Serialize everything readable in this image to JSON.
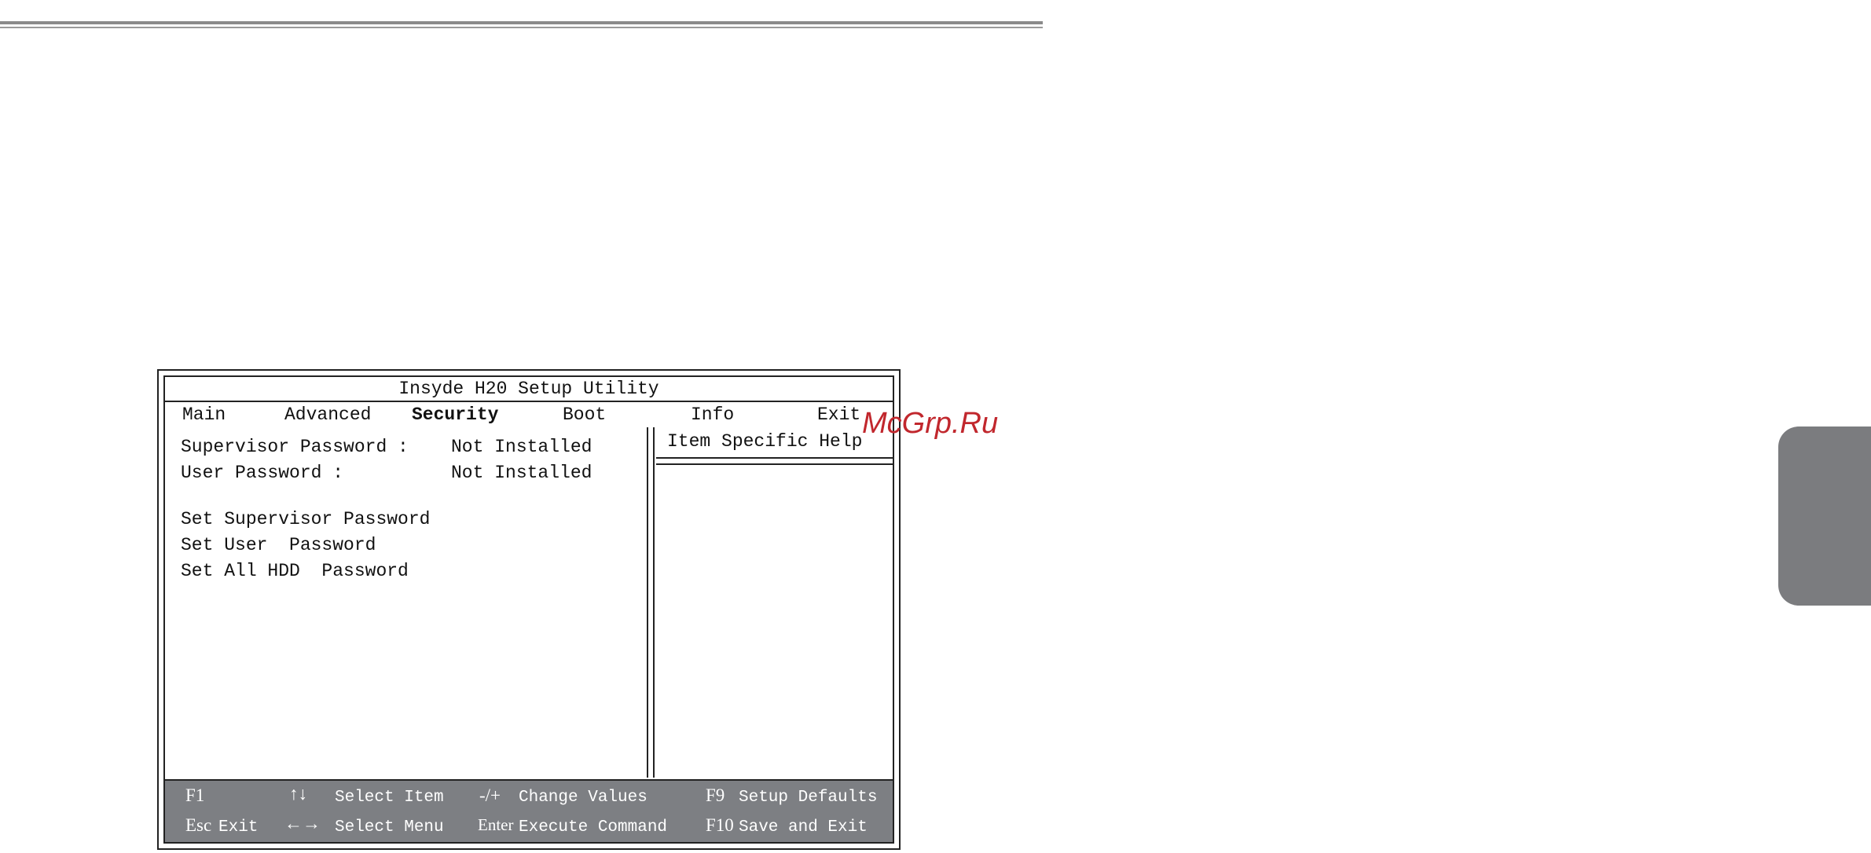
{
  "app": {
    "title": "Insyde H20 Setup Utility"
  },
  "menu": {
    "items": [
      {
        "label": "Main"
      },
      {
        "label": "Advanced"
      },
      {
        "label": "Security",
        "active": true
      },
      {
        "label": "Boot"
      },
      {
        "label": "Info"
      },
      {
        "label": "Exit"
      }
    ]
  },
  "security": {
    "supervisor_label": "Supervisor Password :",
    "supervisor_value": "Not Installed",
    "user_label": "User Password :",
    "user_value": "Not Installed",
    "actions": [
      "Set Supervisor Password",
      "Set User  Password",
      "Set All HDD  Password"
    ]
  },
  "help": {
    "title": "Item Specific Help"
  },
  "footer": {
    "keys": [
      {
        "key": "F1",
        "desc": ""
      },
      {
        "key": "↑↓",
        "desc": "Select Item"
      },
      {
        "key": "-/+",
        "desc": "Change Values"
      },
      {
        "key": "F9",
        "desc": "Setup Defaults"
      },
      {
        "key": "Esc",
        "desc": "Exit"
      },
      {
        "key": "←→",
        "desc": "Select Menu"
      },
      {
        "key": "Enter",
        "desc": "Execute Command"
      },
      {
        "key": "F10",
        "desc": "Save and Exit"
      }
    ]
  },
  "watermark": "McGrp.Ru",
  "colors": {
    "footer_bg": "#7d7f83",
    "watermark": "#c1272d",
    "side_tab": "#7b7c7f"
  }
}
